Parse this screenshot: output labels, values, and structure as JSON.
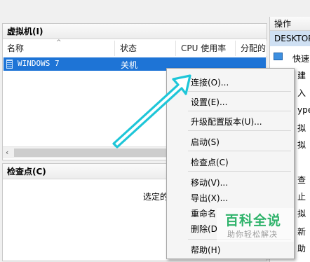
{
  "vm_pane": {
    "title": "虚拟机(I)",
    "columns": [
      "名称",
      "状态",
      "CPU 使用率",
      "分配的"
    ],
    "row": {
      "name": "WINDOWS 7",
      "state": "关机"
    }
  },
  "checkpoint_pane": {
    "title": "检查点(C)",
    "message": "选定的"
  },
  "actions_pane": {
    "title": "操作",
    "host": "DESKTOP",
    "items": [
      "快速",
      "建",
      "入",
      "ype",
      "拟",
      "拟",
      "查",
      "止",
      "拟",
      "新",
      "助"
    ]
  },
  "context_menu": {
    "items": [
      "连接(O)...",
      "设置(E)...",
      "升级配置版本(U)...",
      "启动(S)",
      "检查点(C)",
      "移动(V)...",
      "导出(X)...",
      "重命名",
      "删除(D",
      "帮助(H)"
    ]
  },
  "watermark": {
    "title": "百科全说",
    "subtitle": "助你轻松解决"
  },
  "colors": {
    "selection": "#1e74d6",
    "arrow": "#1ec6d8",
    "watermark_green": "#2fb36b"
  }
}
